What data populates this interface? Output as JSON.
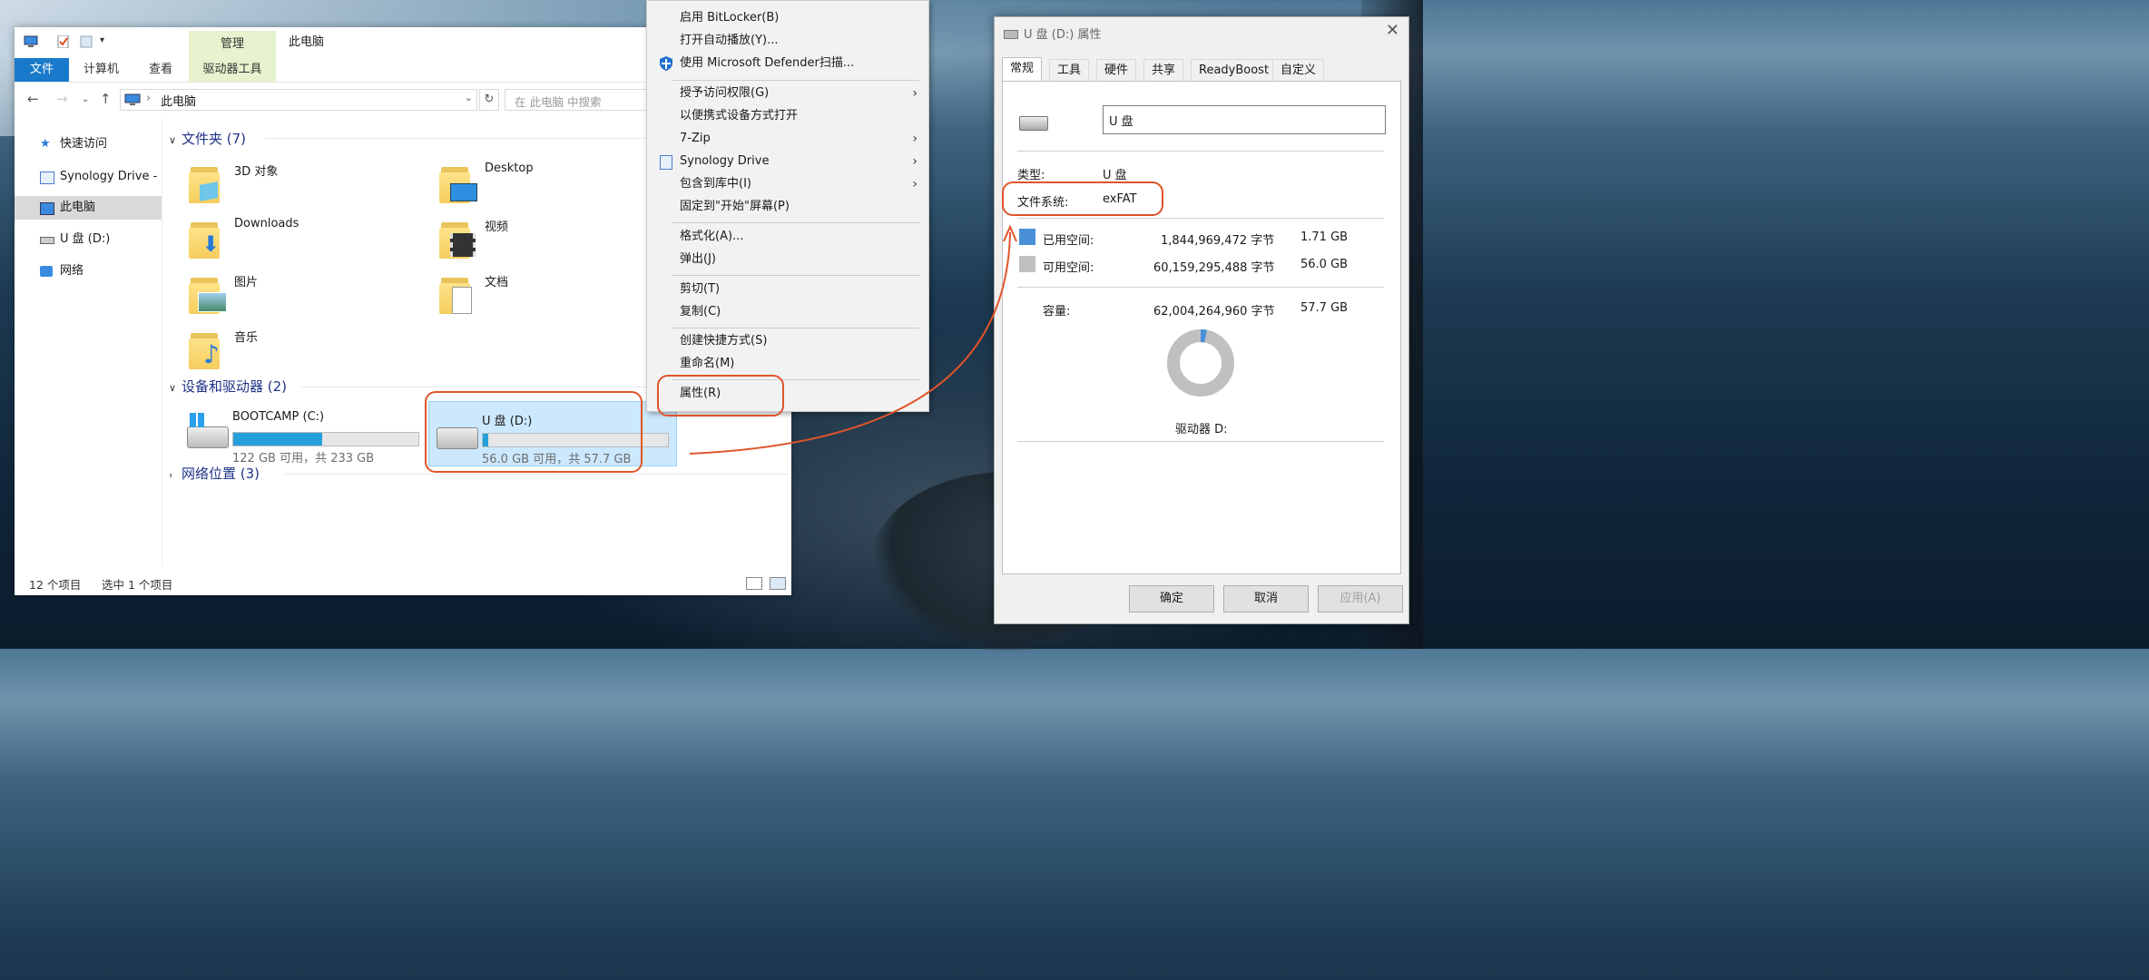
{
  "explorer": {
    "title": "此电脑",
    "context_tab_top": "管理",
    "ribbon_tabs": {
      "file": "文件",
      "computer": "计算机",
      "view": "查看",
      "drive_tools": "驱动器工具"
    },
    "address": "此电脑",
    "search_placeholder": "在 此电脑 中搜索",
    "nav": [
      {
        "label": "快速访问"
      },
      {
        "label": "Synology Drive - I"
      },
      {
        "label": "此电脑"
      },
      {
        "label": "U 盘 (D:)"
      },
      {
        "label": "网络"
      }
    ],
    "folders_header": "文件夹 (7)",
    "folders": [
      {
        "name": "3D 对象"
      },
      {
        "name": "Desktop"
      },
      {
        "name": "Downloads"
      },
      {
        "name": "视频"
      },
      {
        "name": "图片"
      },
      {
        "name": "文档"
      },
      {
        "name": "音乐"
      }
    ],
    "devices_header": "设备和驱动器 (2)",
    "drives": [
      {
        "name": "BOOTCAMP (C:)",
        "info": "122 GB 可用，共 233 GB",
        "used_fraction": 0.48
      },
      {
        "name": "U 盘 (D:)",
        "info": "56.0 GB 可用，共 57.7 GB",
        "used_fraction": 0.03
      }
    ],
    "network_header": "网络位置 (3)",
    "status_items": "12 个项目",
    "status_selected": "选中 1 个项目"
  },
  "context_menu": {
    "items": [
      {
        "label": "启用 BitLocker(B)"
      },
      {
        "label": "打开自动播放(Y)..."
      },
      {
        "label": "使用 Microsoft Defender扫描..."
      },
      {
        "label": "授予访问权限(G)"
      },
      {
        "label": "以便携式设备方式打开"
      },
      {
        "label": "7-Zip"
      },
      {
        "label": "Synology Drive"
      },
      {
        "label": "包含到库中(I)"
      },
      {
        "label": "固定到\"开始\"屏幕(P)"
      },
      {
        "label": "格式化(A)..."
      },
      {
        "label": "弹出(J)"
      },
      {
        "label": "剪切(T)"
      },
      {
        "label": "复制(C)"
      },
      {
        "label": "创建快捷方式(S)"
      },
      {
        "label": "重命名(M)"
      },
      {
        "label": "属性(R)"
      }
    ]
  },
  "properties": {
    "title": "U 盘 (D:) 属性",
    "tabs": [
      "常规",
      "工具",
      "硬件",
      "共享",
      "ReadyBoost",
      "自定义"
    ],
    "name_value": "U 盘",
    "type_label": "类型:",
    "type_value": "U 盘",
    "fs_label": "文件系统:",
    "fs_value": "exFAT",
    "used_label": "已用空间:",
    "used_bytes": "1,844,969,472 字节",
    "used_gb": "1.71 GB",
    "free_label": "可用空间:",
    "free_bytes": "60,159,295,488 字节",
    "free_gb": "56.0 GB",
    "cap_label": "容量:",
    "cap_bytes": "62,004,264,960 字节",
    "cap_gb": "57.7 GB",
    "used_fraction": 0.03,
    "drive_label": "驱动器 D:",
    "ok": "确定",
    "cancel": "取消",
    "apply": "应用(A)",
    "colors": {
      "used": "#4a90d9",
      "free": "#c0c0c0"
    }
  }
}
